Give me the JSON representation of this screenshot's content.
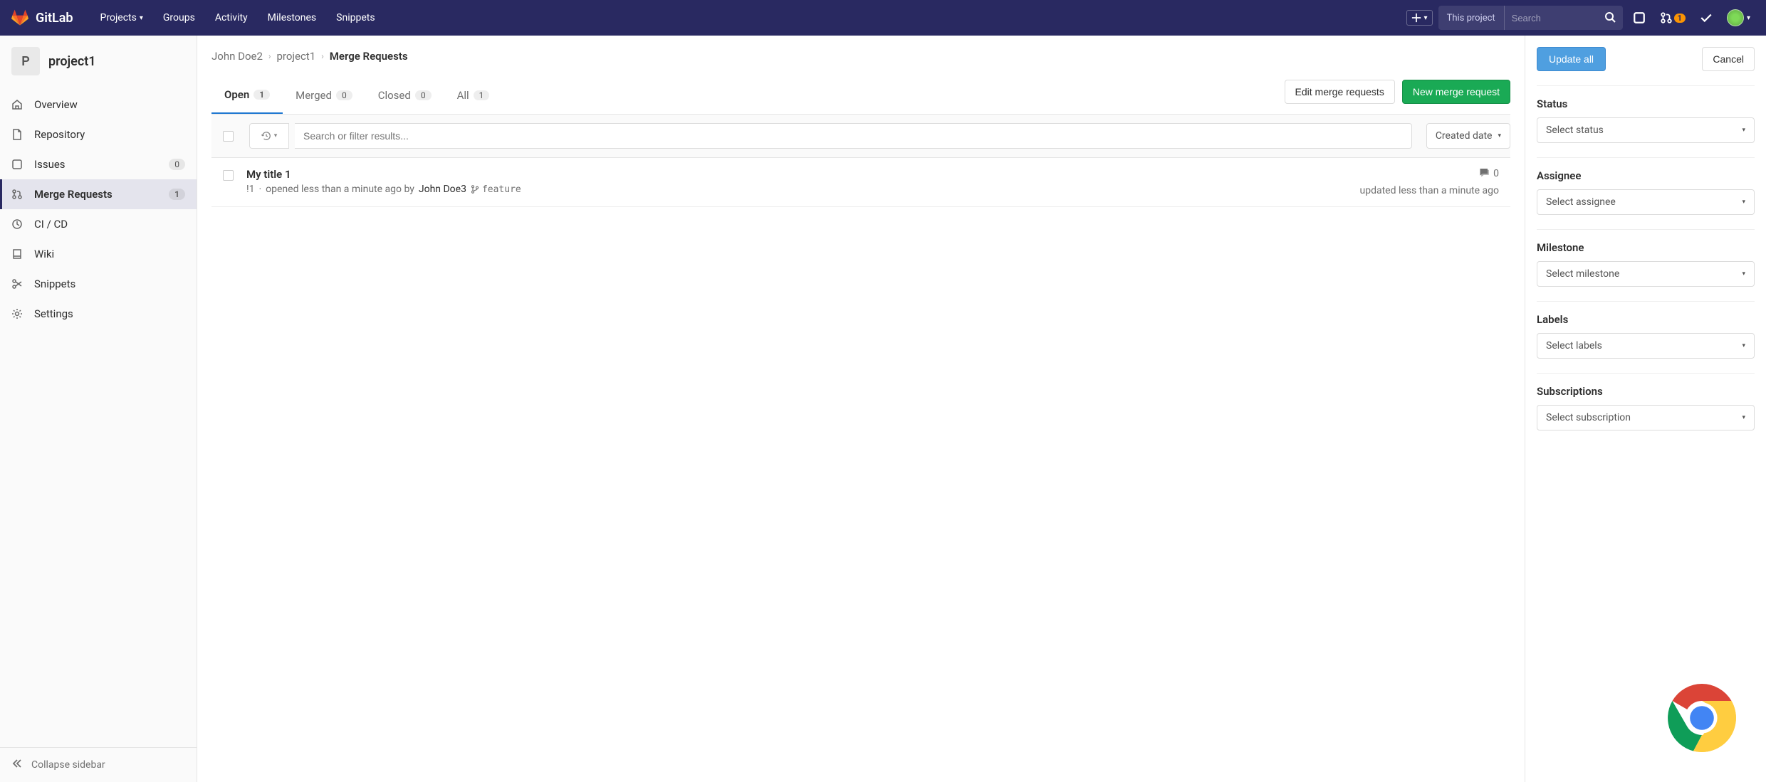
{
  "brand": "GitLab",
  "nav": {
    "projects": "Projects",
    "groups": "Groups",
    "activity": "Activity",
    "milestones": "Milestones",
    "snippets": "Snippets"
  },
  "search": {
    "scope": "This project",
    "placeholder": "Search"
  },
  "nav_badges": {
    "mr": "1"
  },
  "sidebar": {
    "project_initial": "P",
    "project_name": "project1",
    "items": [
      {
        "label": "Overview"
      },
      {
        "label": "Repository"
      },
      {
        "label": "Issues",
        "badge": "0"
      },
      {
        "label": "Merge Requests",
        "badge": "1"
      },
      {
        "label": "CI / CD"
      },
      {
        "label": "Wiki"
      },
      {
        "label": "Snippets"
      },
      {
        "label": "Settings"
      }
    ],
    "collapse": "Collapse sidebar"
  },
  "breadcrumbs": {
    "user": "John Doe2",
    "project": "project1",
    "current": "Merge Requests"
  },
  "tabs": {
    "open": {
      "label": "Open",
      "count": "1"
    },
    "merged": {
      "label": "Merged",
      "count": "0"
    },
    "closed": {
      "label": "Closed",
      "count": "0"
    },
    "all": {
      "label": "All",
      "count": "1"
    }
  },
  "actions": {
    "edit": "Edit merge requests",
    "new": "New merge request"
  },
  "filter": {
    "placeholder": "Search or filter results...",
    "sort": "Created date"
  },
  "mr": {
    "title": "My title 1",
    "ref": "!1",
    "opened_sep": " · ",
    "opened_text": "opened less than a minute ago by ",
    "author": "John Doe3",
    "branch": "feature",
    "updated": "updated less than a minute ago",
    "comments": "0"
  },
  "bulk": {
    "update": "Update all",
    "cancel": "Cancel",
    "status": {
      "label": "Status",
      "placeholder": "Select status"
    },
    "assignee": {
      "label": "Assignee",
      "placeholder": "Select assignee"
    },
    "milestone": {
      "label": "Milestone",
      "placeholder": "Select milestone"
    },
    "labels": {
      "label": "Labels",
      "placeholder": "Select labels"
    },
    "subscriptions": {
      "label": "Subscriptions",
      "placeholder": "Select subscription"
    }
  }
}
